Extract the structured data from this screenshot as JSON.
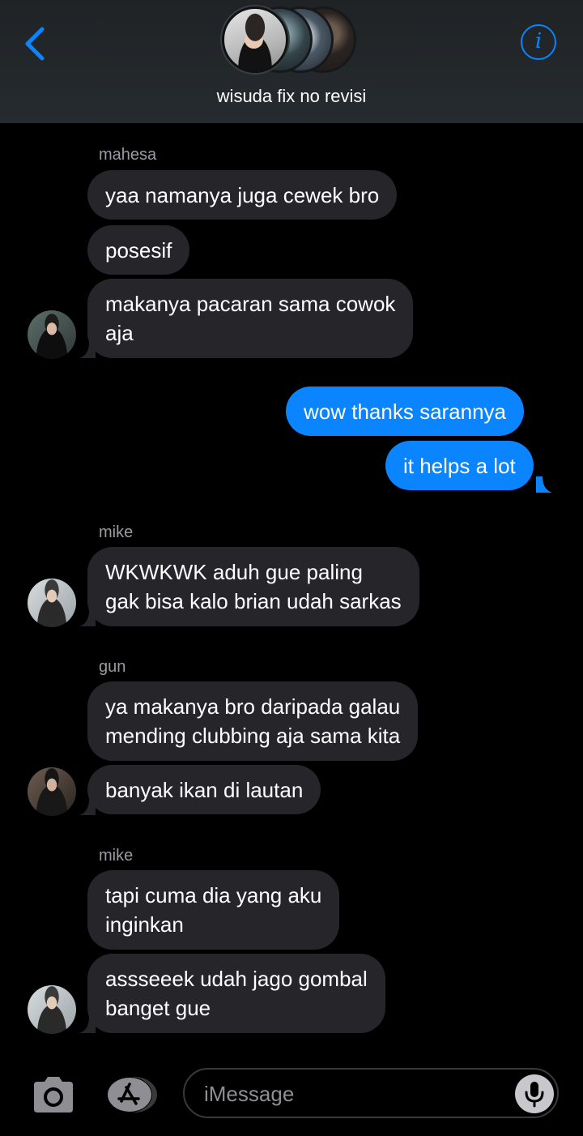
{
  "header": {
    "group_name": "wisuda fix no revisi",
    "back_icon": "chevron-left-icon",
    "info_icon": "info-icon",
    "info_label": "i",
    "accent_color": "#0a84ff"
  },
  "messages": {
    "m1_sender": "mahesa",
    "m1_text": "yaa namanya juga cewek bro",
    "m2_text": "posesif",
    "m3_line1": "makanya pacaran sama cowok",
    "m3_line2": "aja",
    "m4_text": "wow thanks sarannya",
    "m5_text": "it helps a lot",
    "m6_sender": "mike",
    "m6_line1": "WKWKWK aduh gue paling",
    "m6_line2": "gak bisa kalo brian udah sarkas",
    "m7_sender": "gun",
    "m7_line1": "ya makanya bro daripada galau",
    "m7_line2": "mending clubbing aja sama kita",
    "m8_text": "banyak ikan di lautan",
    "m9_sender": "mike",
    "m9_line1": "tapi cuma dia yang aku",
    "m9_line2": "inginkan",
    "m10_line1": "assseeek udah jago gombal",
    "m10_line2": "banget gue"
  },
  "composer": {
    "placeholder": "iMessage",
    "camera_icon": "camera-icon",
    "apps_icon": "app-store-icon",
    "mic_icon": "microphone-icon"
  },
  "colors": {
    "incoming_bubble": "#26252a",
    "outgoing_bubble": "#0a84ff",
    "sender_label": "#9b9ba1"
  }
}
